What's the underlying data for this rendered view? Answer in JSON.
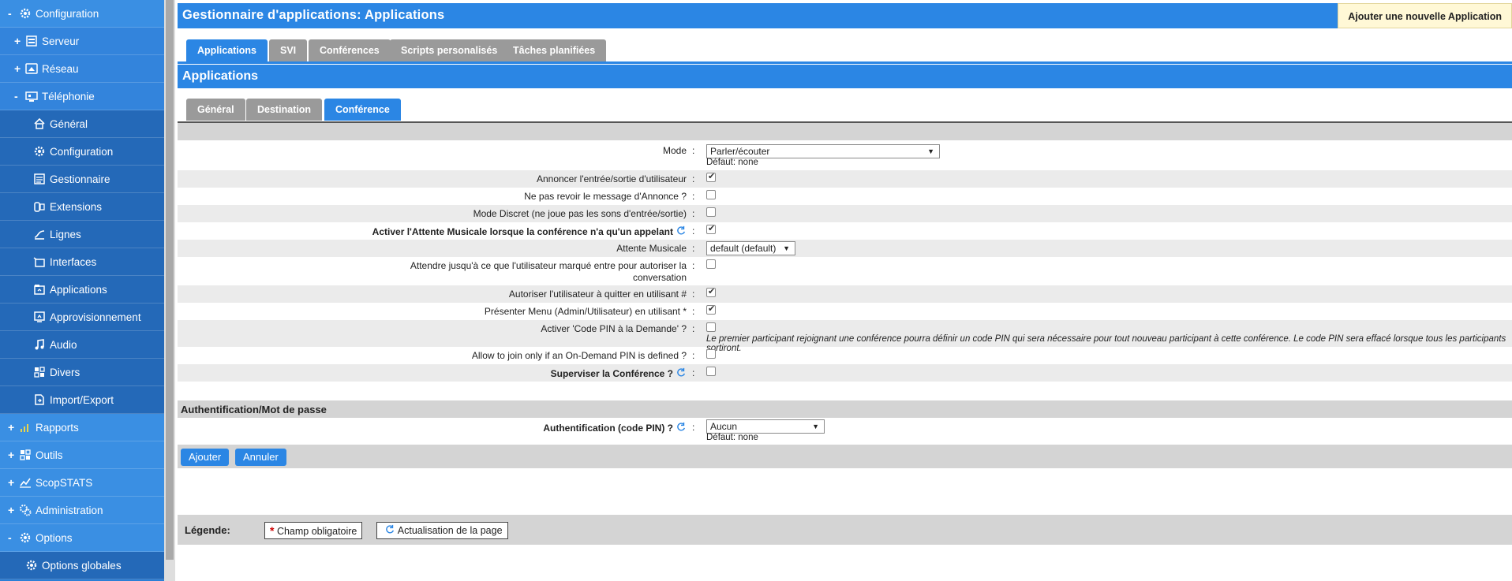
{
  "sidebar": {
    "items": [
      {
        "label": "Configuration",
        "toggle": "-",
        "icon": "gear-icon"
      },
      {
        "label": "Serveur",
        "toggle": "+",
        "icon": "server-icon"
      },
      {
        "label": "Réseau",
        "toggle": "+",
        "icon": "network-icon"
      },
      {
        "label": "Téléphonie",
        "toggle": "-",
        "icon": "telephony-icon"
      },
      {
        "label": "Général",
        "icon": "home-icon"
      },
      {
        "label": "Configuration",
        "icon": "gear-icon"
      },
      {
        "label": "Gestionnaire",
        "icon": "manager-icon"
      },
      {
        "label": "Extensions",
        "icon": "extensions-icon"
      },
      {
        "label": "Lignes",
        "icon": "lines-icon"
      },
      {
        "label": "Interfaces",
        "icon": "interfaces-icon"
      },
      {
        "label": "Applications",
        "icon": "applications-icon"
      },
      {
        "label": "Approvisionnement",
        "icon": "provisioning-icon"
      },
      {
        "label": "Audio",
        "icon": "music-note-icon"
      },
      {
        "label": "Divers",
        "icon": "grid-icon"
      },
      {
        "label": "Import/Export",
        "icon": "import-export-icon"
      },
      {
        "label": "Rapports",
        "toggle": "+",
        "icon": "bar-chart-icon"
      },
      {
        "label": "Outils",
        "toggle": "+",
        "icon": "tools-icon"
      },
      {
        "label": "ScopSTATS",
        "toggle": "+",
        "icon": "line-chart-icon"
      },
      {
        "label": "Administration",
        "toggle": "+",
        "icon": "admin-gear-icon"
      },
      {
        "label": "Options",
        "toggle": "-",
        "icon": "gear-icon"
      },
      {
        "label": "Options globales",
        "icon": "gear-icon"
      }
    ]
  },
  "header": {
    "title": "Gestionnaire d'applications:  Applications",
    "add_button": "Ajouter une nouvelle Application"
  },
  "top_tabs": [
    "Applications",
    "SVI",
    "Conférences",
    "Scripts personalisés",
    "Tâches planifiées"
  ],
  "section_title": "Applications",
  "sub_tabs": [
    "Général",
    "Destination",
    "Conférence"
  ],
  "form": {
    "mode": {
      "label": "Mode",
      "value": "Parler/écouter",
      "default": "Défaut: none"
    },
    "announce": {
      "label": "Annoncer l'entrée/sortie d'utilisateur",
      "checked": true
    },
    "no_replay": {
      "label": "Ne pas revoir le message d'Annonce ?",
      "checked": false
    },
    "discreet": {
      "label": "Mode Discret (ne joue pas les sons d'entrée/sortie)",
      "checked": false
    },
    "moh_single": {
      "label": "Activer l'Attente Musicale lorsque la conférence n'a qu'un appelant",
      "checked": true
    },
    "moh": {
      "label": "Attente Musicale",
      "value": "default (default)"
    },
    "wait_marked": {
      "label_line1": "Attendre jusqu'à ce que l'utilisateur marqué entre pour autoriser la",
      "label_line2": "conversation",
      "checked": false
    },
    "allow_quit": {
      "label": "Autoriser l'utilisateur à quitter en utilisant #",
      "checked": true
    },
    "present_menu": {
      "label": "Présenter Menu (Admin/Utilisateur) en utilisant *",
      "checked": true
    },
    "pin_on_demand": {
      "label": "Activer 'Code PIN à la Demande' ?",
      "checked": false,
      "help": "Le premier participant rejoignant une conférence pourra définir un code PIN qui sera nécessaire pour tout nouveau participant à cette conférence. Le code PIN sera effacé lorsque tous les participants sortiront."
    },
    "allow_join": {
      "label": "Allow to join only if an On-Demand PIN is defined ?",
      "checked": false
    },
    "supervise": {
      "label": "Superviser la Conférence ?",
      "checked": false
    }
  },
  "auth": {
    "section_title": "Authentification/Mot de passe",
    "label": "Authentification (code PIN) ?",
    "value": "Aucun",
    "default": "Défaut: none"
  },
  "buttons": {
    "add": "Ajouter",
    "cancel": "Annuler"
  },
  "legend": {
    "title": "Légende:",
    "required": "Champ obligatoire",
    "refresh": "Actualisation de la page"
  },
  "colors": {
    "accent": "#2b86e4",
    "sidebar": "#2b7fd6",
    "tab_inactive": "#9a9a9a",
    "add_button_bg": "#fff8d6"
  }
}
